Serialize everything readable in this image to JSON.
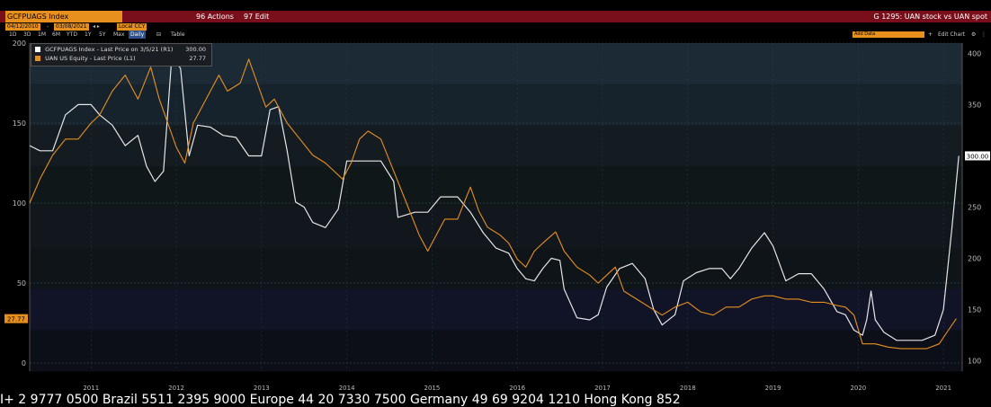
{
  "header": {
    "ticker": "GCFPUAGS Index",
    "actions_label": "96 Actions",
    "edit_label": "97 Edit",
    "title": "G 1295: UAN stock vs UAN spot",
    "start_date": "04/12/2010",
    "end_date": "03/08/2021",
    "currency": "Local CCY"
  },
  "toolbar": {
    "ranges": [
      "1D",
      "3D",
      "1M",
      "6M",
      "YTD",
      "1Y",
      "5Y",
      "Max"
    ],
    "freq": "Daily",
    "table_label": "Table",
    "notes_label": "Add Data",
    "edit_chart_label": "Edit Chart"
  },
  "legend": {
    "items": [
      {
        "label": "GCFPUAGS Index - Last Price on 3/5/21 (R1)",
        "value": "300.00",
        "color": "#ffffff"
      },
      {
        "label": "UAN US Equity - Last Price (L1)",
        "value": "27.77",
        "color": "#e8901e"
      }
    ]
  },
  "chart_data": {
    "type": "line",
    "x_ticks": [
      "2011",
      "2012",
      "2013",
      "2014",
      "2015",
      "2016",
      "2017",
      "2018",
      "2019",
      "2020",
      "2021"
    ],
    "left_axis": {
      "ticks": [
        0,
        50,
        100,
        150,
        200
      ],
      "ylim": [
        -5,
        200
      ]
    },
    "right_axis": {
      "ticks": [
        100,
        150,
        200,
        250,
        300,
        350,
        400
      ],
      "ylim": [
        90,
        410
      ]
    },
    "last_left_label": "27.77",
    "last_right_label": "300.00",
    "series": [
      {
        "name": "GCFPUAGS Index - Last Price on 3/5/21 (R1)",
        "axis": "right",
        "color": "#e6e6e6",
        "points": [
          [
            2010.28,
            310
          ],
          [
            2010.4,
            305
          ],
          [
            2010.55,
            305
          ],
          [
            2010.7,
            340
          ],
          [
            2010.85,
            350
          ],
          [
            2011.0,
            350
          ],
          [
            2011.1,
            340
          ],
          [
            2011.25,
            330
          ],
          [
            2011.4,
            310
          ],
          [
            2011.55,
            320
          ],
          [
            2011.65,
            290
          ],
          [
            2011.75,
            275
          ],
          [
            2011.85,
            285
          ],
          [
            2011.95,
            400
          ],
          [
            2012.05,
            385
          ],
          [
            2012.15,
            300
          ],
          [
            2012.25,
            330
          ],
          [
            2012.4,
            328
          ],
          [
            2012.55,
            320
          ],
          [
            2012.7,
            318
          ],
          [
            2012.85,
            300
          ],
          [
            2013.0,
            300
          ],
          [
            2013.1,
            345
          ],
          [
            2013.2,
            348
          ],
          [
            2013.3,
            305
          ],
          [
            2013.4,
            255
          ],
          [
            2013.5,
            250
          ],
          [
            2013.6,
            235
          ],
          [
            2013.75,
            230
          ],
          [
            2013.9,
            248
          ],
          [
            2014.0,
            295
          ],
          [
            2014.2,
            295
          ],
          [
            2014.4,
            295
          ],
          [
            2014.55,
            275
          ],
          [
            2014.6,
            240
          ],
          [
            2014.8,
            245
          ],
          [
            2014.95,
            245
          ],
          [
            2015.1,
            260
          ],
          [
            2015.3,
            260
          ],
          [
            2015.45,
            245
          ],
          [
            2015.6,
            225
          ],
          [
            2015.75,
            210
          ],
          [
            2015.9,
            205
          ],
          [
            2016.0,
            190
          ],
          [
            2016.1,
            180
          ],
          [
            2016.2,
            178
          ],
          [
            2016.3,
            190
          ],
          [
            2016.4,
            200
          ],
          [
            2016.5,
            198
          ],
          [
            2016.55,
            170
          ],
          [
            2016.7,
            142
          ],
          [
            2016.85,
            140
          ],
          [
            2016.95,
            145
          ],
          [
            2017.05,
            172
          ],
          [
            2017.2,
            190
          ],
          [
            2017.35,
            195
          ],
          [
            2017.5,
            180
          ],
          [
            2017.6,
            150
          ],
          [
            2017.7,
            135
          ],
          [
            2017.85,
            145
          ],
          [
            2017.95,
            178
          ],
          [
            2018.1,
            186
          ],
          [
            2018.25,
            190
          ],
          [
            2018.4,
            190
          ],
          [
            2018.5,
            180
          ],
          [
            2018.6,
            190
          ],
          [
            2018.75,
            210
          ],
          [
            2018.9,
            225
          ],
          [
            2019.0,
            212
          ],
          [
            2019.15,
            178
          ],
          [
            2019.3,
            185
          ],
          [
            2019.45,
            185
          ],
          [
            2019.6,
            170
          ],
          [
            2019.75,
            148
          ],
          [
            2019.85,
            145
          ],
          [
            2019.95,
            130
          ],
          [
            2020.05,
            125
          ],
          [
            2020.1,
            140
          ],
          [
            2020.15,
            168
          ],
          [
            2020.2,
            140
          ],
          [
            2020.3,
            128
          ],
          [
            2020.45,
            120
          ],
          [
            2020.6,
            120
          ],
          [
            2020.75,
            120
          ],
          [
            2020.9,
            125
          ],
          [
            2021.0,
            150
          ],
          [
            2021.1,
            230
          ],
          [
            2021.18,
            300
          ]
        ]
      },
      {
        "name": "UAN US Equity - Last Price (L1)",
        "axis": "left",
        "color": "#e8901e",
        "points": [
          [
            2010.28,
            100
          ],
          [
            2010.4,
            115
          ],
          [
            2010.55,
            130
          ],
          [
            2010.7,
            140
          ],
          [
            2010.85,
            140
          ],
          [
            2011.0,
            150
          ],
          [
            2011.1,
            155
          ],
          [
            2011.25,
            170
          ],
          [
            2011.4,
            180
          ],
          [
            2011.55,
            165
          ],
          [
            2011.7,
            185
          ],
          [
            2011.8,
            165
          ],
          [
            2011.9,
            150
          ],
          [
            2012.0,
            135
          ],
          [
            2012.1,
            125
          ],
          [
            2012.2,
            150
          ],
          [
            2012.35,
            165
          ],
          [
            2012.5,
            180
          ],
          [
            2012.6,
            170
          ],
          [
            2012.75,
            175
          ],
          [
            2012.85,
            190
          ],
          [
            2012.95,
            175
          ],
          [
            2013.05,
            160
          ],
          [
            2013.15,
            165
          ],
          [
            2013.3,
            150
          ],
          [
            2013.45,
            140
          ],
          [
            2013.6,
            130
          ],
          [
            2013.75,
            125
          ],
          [
            2013.85,
            120
          ],
          [
            2013.95,
            115
          ],
          [
            2014.05,
            125
          ],
          [
            2014.15,
            140
          ],
          [
            2014.25,
            145
          ],
          [
            2014.4,
            140
          ],
          [
            2014.55,
            120
          ],
          [
            2014.7,
            100
          ],
          [
            2014.85,
            80
          ],
          [
            2014.95,
            70
          ],
          [
            2015.05,
            80
          ],
          [
            2015.15,
            90
          ],
          [
            2015.3,
            90
          ],
          [
            2015.45,
            110
          ],
          [
            2015.55,
            95
          ],
          [
            2015.65,
            85
          ],
          [
            2015.8,
            80
          ],
          [
            2015.9,
            75
          ],
          [
            2016.0,
            65
          ],
          [
            2016.1,
            60
          ],
          [
            2016.2,
            70
          ],
          [
            2016.3,
            75
          ],
          [
            2016.45,
            82
          ],
          [
            2016.55,
            70
          ],
          [
            2016.7,
            60
          ],
          [
            2016.85,
            55
          ],
          [
            2016.95,
            50
          ],
          [
            2017.05,
            55
          ],
          [
            2017.15,
            60
          ],
          [
            2017.25,
            45
          ],
          [
            2017.4,
            40
          ],
          [
            2017.55,
            35
          ],
          [
            2017.7,
            30
          ],
          [
            2017.85,
            35
          ],
          [
            2018.0,
            38
          ],
          [
            2018.15,
            32
          ],
          [
            2018.3,
            30
          ],
          [
            2018.45,
            35
          ],
          [
            2018.6,
            35
          ],
          [
            2018.75,
            40
          ],
          [
            2018.9,
            42
          ],
          [
            2019.0,
            42
          ],
          [
            2019.15,
            40
          ],
          [
            2019.3,
            40
          ],
          [
            2019.45,
            38
          ],
          [
            2019.6,
            38
          ],
          [
            2019.75,
            36
          ],
          [
            2019.85,
            35
          ],
          [
            2019.95,
            30
          ],
          [
            2020.05,
            12
          ],
          [
            2020.2,
            12
          ],
          [
            2020.35,
            10
          ],
          [
            2020.5,
            9
          ],
          [
            2020.65,
            9
          ],
          [
            2020.8,
            9
          ],
          [
            2020.95,
            12
          ],
          [
            2021.05,
            20
          ],
          [
            2021.15,
            27.77
          ]
        ]
      }
    ]
  },
  "bottom_ticker": "I+ 2 9777 0500 Brazil 5511 2395 9000 Europe 44 20 7330 7500 Germany 49 69 9204 1210 Hong Kong 852"
}
